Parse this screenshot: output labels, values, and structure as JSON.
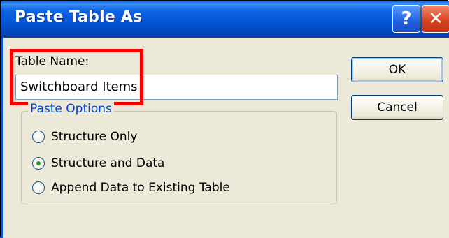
{
  "dialog": {
    "title": "Paste Table As",
    "help_glyph": "?",
    "close_glyph": "✕"
  },
  "table_name": {
    "label": "Table Name:",
    "value": "Switchboard Items"
  },
  "buttons": {
    "ok": "OK",
    "cancel": "Cancel"
  },
  "paste_options": {
    "label": "Paste Options",
    "options": [
      {
        "label": "Structure Only",
        "selected": false
      },
      {
        "label": "Structure and Data",
        "selected": true
      },
      {
        "label": "Append Data to Existing Table",
        "selected": false
      }
    ]
  },
  "colors": {
    "titlebar": "#0554d3",
    "highlight_box": "#ff0000",
    "group_label": "#0046d5"
  }
}
